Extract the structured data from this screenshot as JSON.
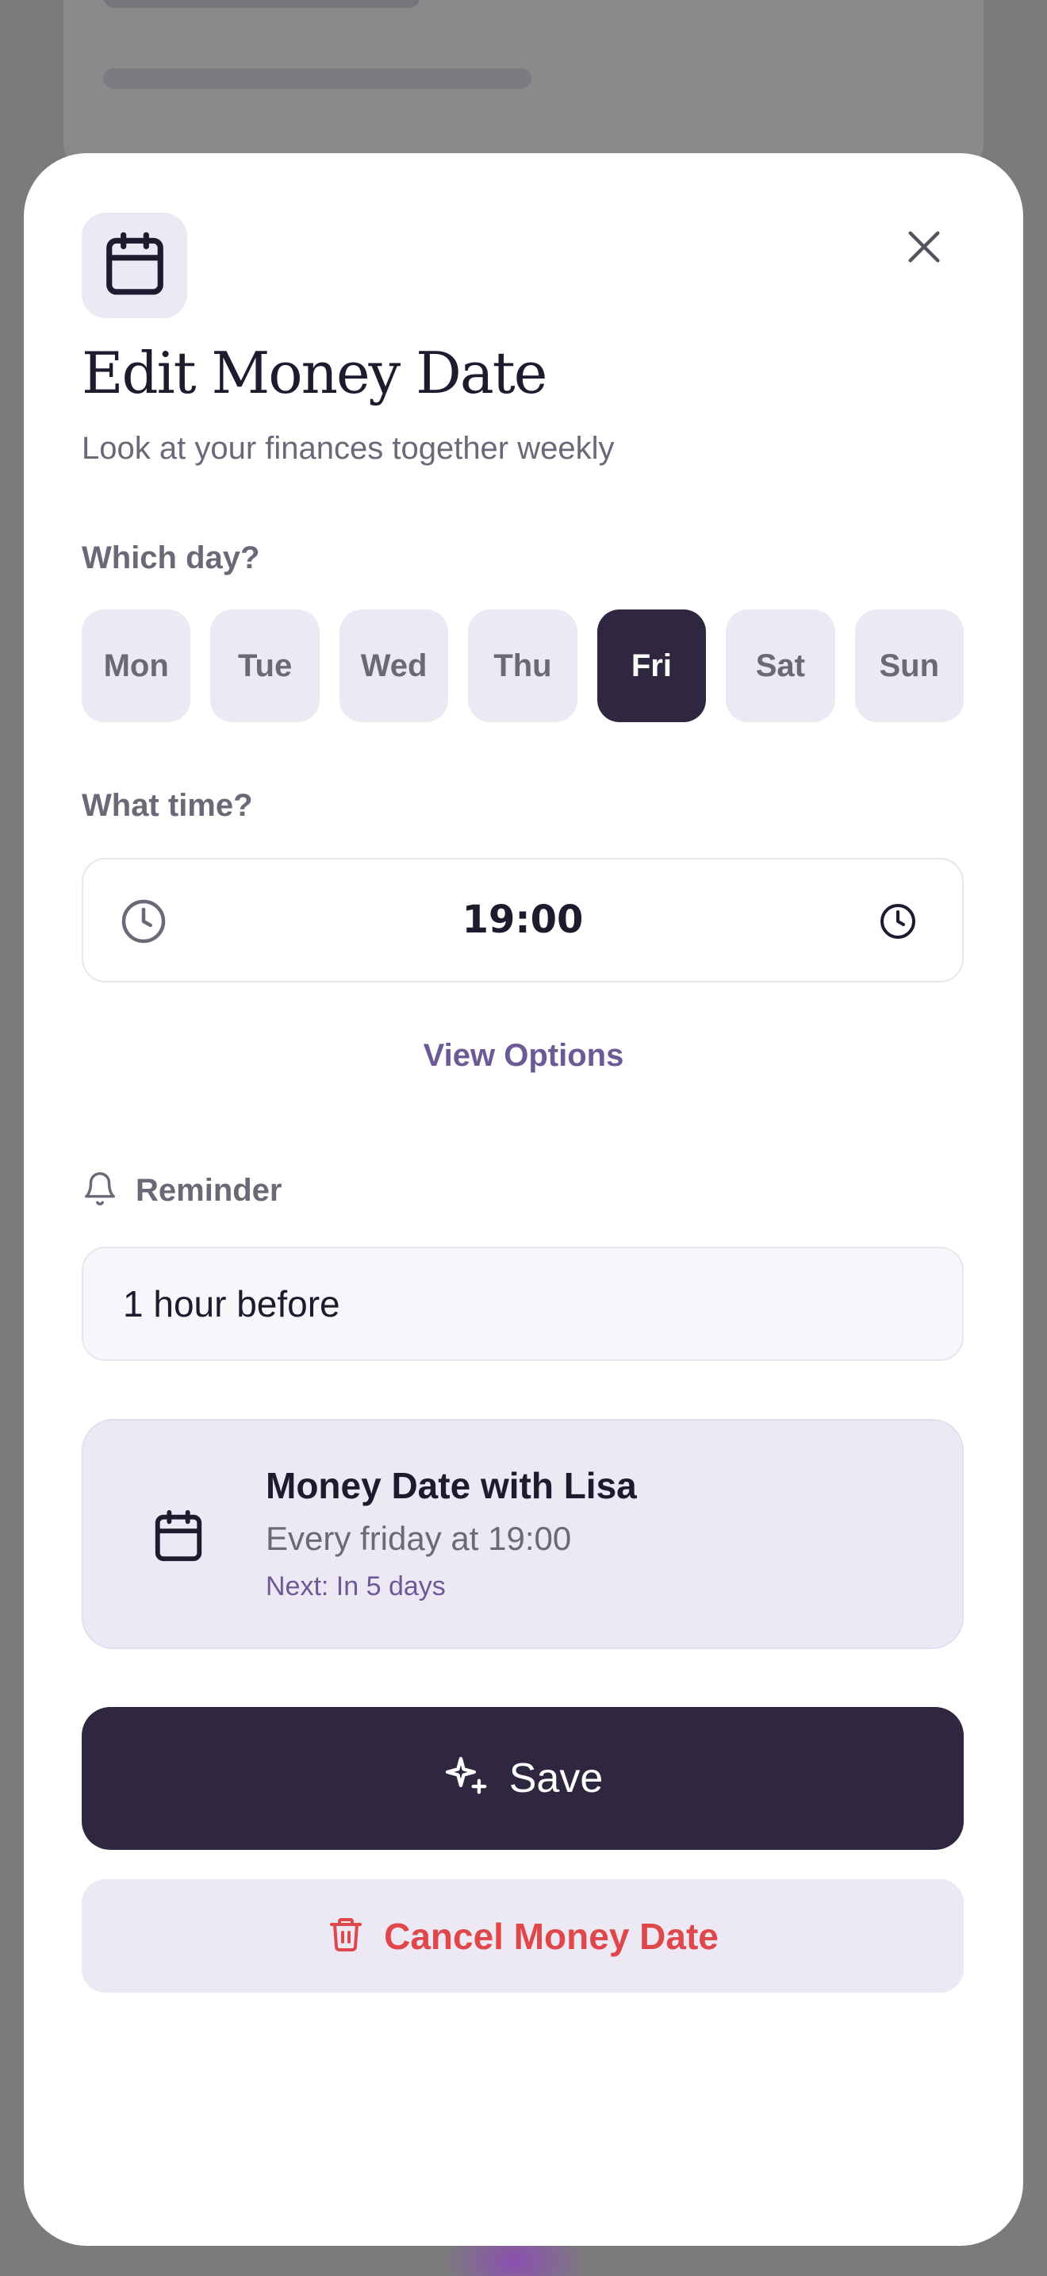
{
  "modal": {
    "title": "Edit Money Date",
    "subtitle": "Look at your finances together weekly"
  },
  "day_picker": {
    "label": "Which day?",
    "days": [
      "Mon",
      "Tue",
      "Wed",
      "Thu",
      "Fri",
      "Sat",
      "Sun"
    ],
    "selected": "Fri"
  },
  "time_picker": {
    "label": "What time?",
    "value": "19:00"
  },
  "view_options_label": "View Options",
  "reminder": {
    "label": "Reminder",
    "value": "1 hour before"
  },
  "summary": {
    "title": "Money Date with Lisa",
    "schedule": "Every friday at 19:00",
    "next": "Next: In 5 days"
  },
  "actions": {
    "save_label": "Save",
    "cancel_label": "Cancel Money Date"
  },
  "colors": {
    "primary": "#2f2740",
    "accent": "#6c5a96",
    "danger": "#e0474a",
    "surface_tint": "#ece9f5"
  },
  "icons": {
    "header": "calendar-icon",
    "close": "close-icon",
    "time_left": "clock-icon",
    "time_right": "clock-icon",
    "reminder": "bell-icon",
    "summary": "calendar-icon",
    "save": "sparkles-icon",
    "cancel": "trash-icon"
  }
}
